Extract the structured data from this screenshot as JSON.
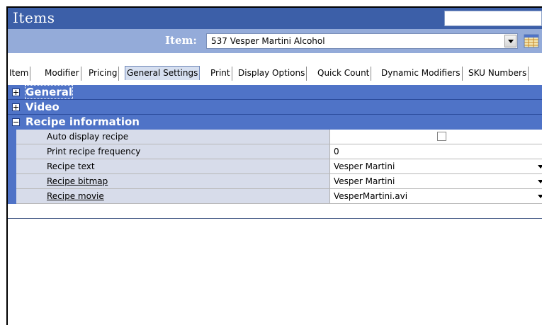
{
  "window": {
    "title": "Items"
  },
  "item_selector": {
    "label": "Item:",
    "value": "537 Vesper Martini Alcohol"
  },
  "tabs": [
    {
      "label": "Item"
    },
    {
      "label": "Modifier"
    },
    {
      "label": "Pricing"
    },
    {
      "label": "General Settings",
      "active": true
    },
    {
      "label": "Print"
    },
    {
      "label": "Display Options"
    },
    {
      "label": "Quick Count"
    },
    {
      "label": "Dynamic Modifiers"
    },
    {
      "label": "SKU Numbers"
    }
  ],
  "sections": [
    {
      "label": "General",
      "expanded": false
    },
    {
      "label": "Video",
      "expanded": false
    },
    {
      "label": "Recipe information",
      "expanded": true
    }
  ],
  "recipe_rows": [
    {
      "name": "Auto display recipe",
      "value": "",
      "type": "checkbox",
      "checked": false
    },
    {
      "name": "Print recipe frequency",
      "value": "0",
      "type": "text"
    },
    {
      "name": "Recipe text",
      "value": "Vesper Martini",
      "type": "dropdown"
    },
    {
      "name": "Recipe bitmap",
      "value": "Vesper Martini",
      "type": "dropdown"
    },
    {
      "name": "Recipe movie",
      "value": "VesperMartini.avi",
      "type": "dropdown"
    }
  ],
  "colors": {
    "title_bar": "#3c5fa8",
    "item_bar": "#94abd9",
    "section_header": "#4f73c7",
    "row_name_bg": "#d7dcea"
  }
}
